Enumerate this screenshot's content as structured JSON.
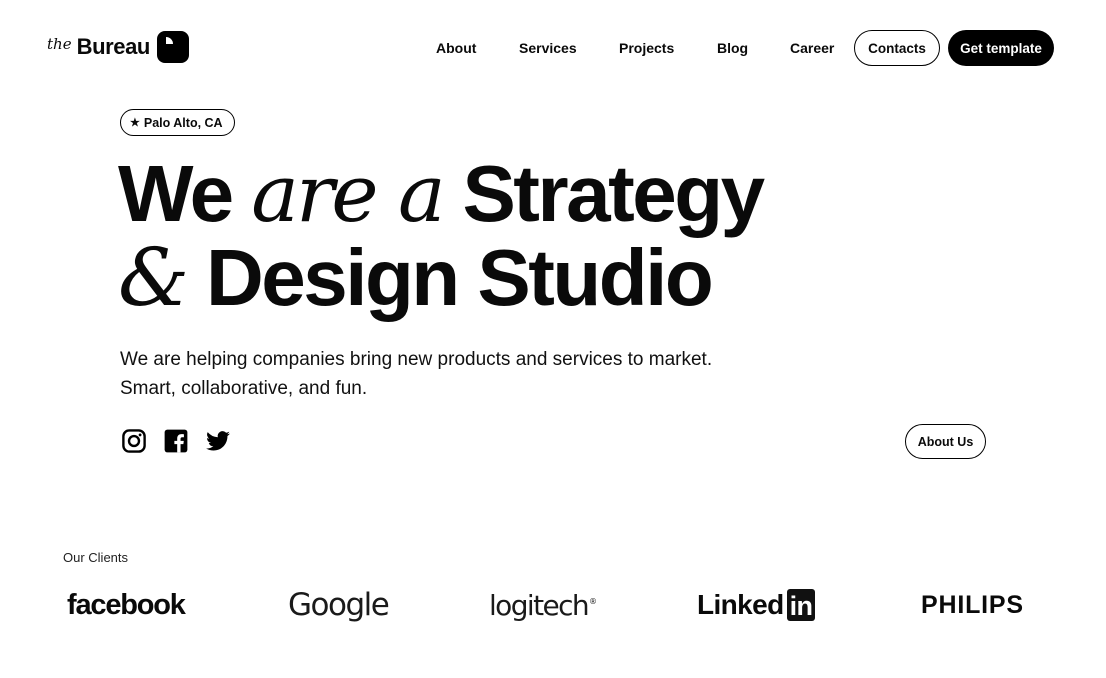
{
  "header": {
    "logo_prefix": "the",
    "logo_name": "Bureau",
    "nav": [
      {
        "label": "About"
      },
      {
        "label": "Services"
      },
      {
        "label": "Projects"
      },
      {
        "label": "Blog"
      },
      {
        "label": "Career"
      }
    ],
    "contacts_label": "Contacts",
    "cta_label": "Get template"
  },
  "hero": {
    "location": "Palo Alto, CA",
    "headline_line1": [
      "We",
      "are a",
      "Strategy"
    ],
    "headline_line2": [
      "&",
      "Design Studio"
    ],
    "subtext_line1": "We are helping companies bring new products and services to market.",
    "subtext_line2": "Smart, collaborative, and fun.",
    "social_icons": [
      "instagram-icon",
      "facebook-icon",
      "twitter-icon"
    ],
    "about_button": "About Us"
  },
  "clients": {
    "label": "Our Clients",
    "logos": [
      "facebook",
      "Google",
      "logitech",
      "Linked",
      "in",
      "PHILIPS"
    ]
  },
  "colors": {
    "background": "#ffffff",
    "text": "#0a0a0a",
    "accent": "#000000"
  }
}
